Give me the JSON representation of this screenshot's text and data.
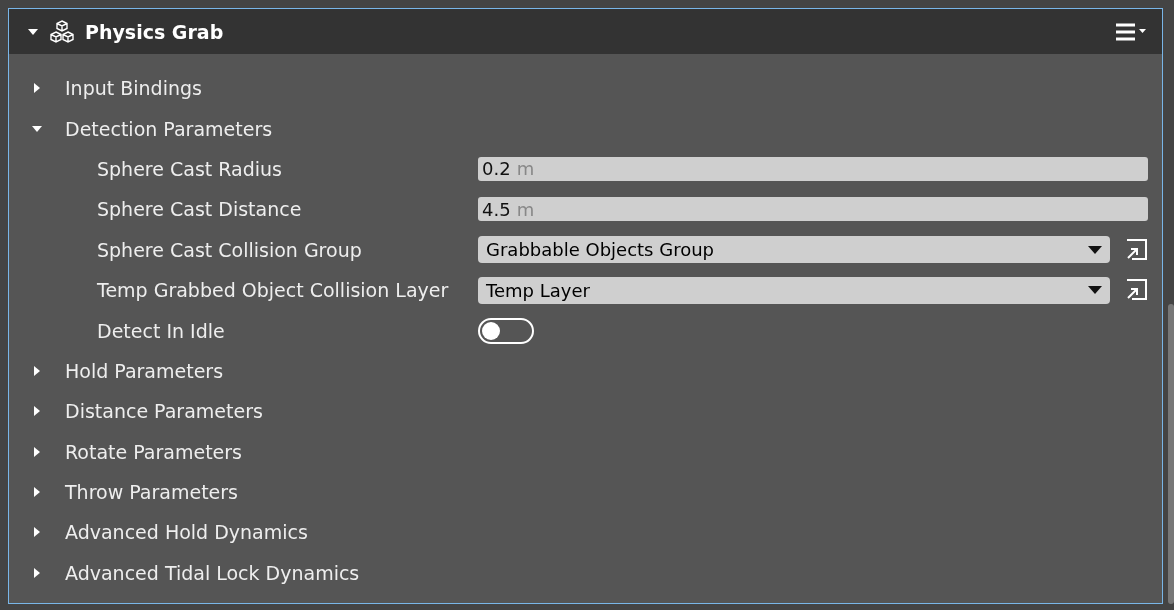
{
  "component": {
    "title": "Physics Grab",
    "expanded": true
  },
  "sections": [
    {
      "label": "Input Bindings",
      "expanded": false
    },
    {
      "label": "Detection Parameters",
      "expanded": true,
      "properties": [
        {
          "kind": "number",
          "label": "Sphere Cast Radius",
          "value": "0.2",
          "unit": "m"
        },
        {
          "kind": "number",
          "label": "Sphere Cast Distance",
          "value": "4.5",
          "unit": "m"
        },
        {
          "kind": "dropdown",
          "label": "Sphere Cast Collision Group",
          "value": "Grabbable Objects Group"
        },
        {
          "kind": "dropdown",
          "label": "Temp Grabbed Object Collision Layer",
          "value": "Temp Layer"
        },
        {
          "kind": "toggle",
          "label": "Detect In Idle",
          "on": false
        }
      ]
    },
    {
      "label": "Hold Parameters",
      "expanded": false
    },
    {
      "label": "Distance Parameters",
      "expanded": false
    },
    {
      "label": "Rotate Parameters",
      "expanded": false
    },
    {
      "label": "Throw Parameters",
      "expanded": false
    },
    {
      "label": "Advanced Hold Dynamics",
      "expanded": false
    },
    {
      "label": "Advanced Tidal Lock Dynamics",
      "expanded": false
    }
  ]
}
